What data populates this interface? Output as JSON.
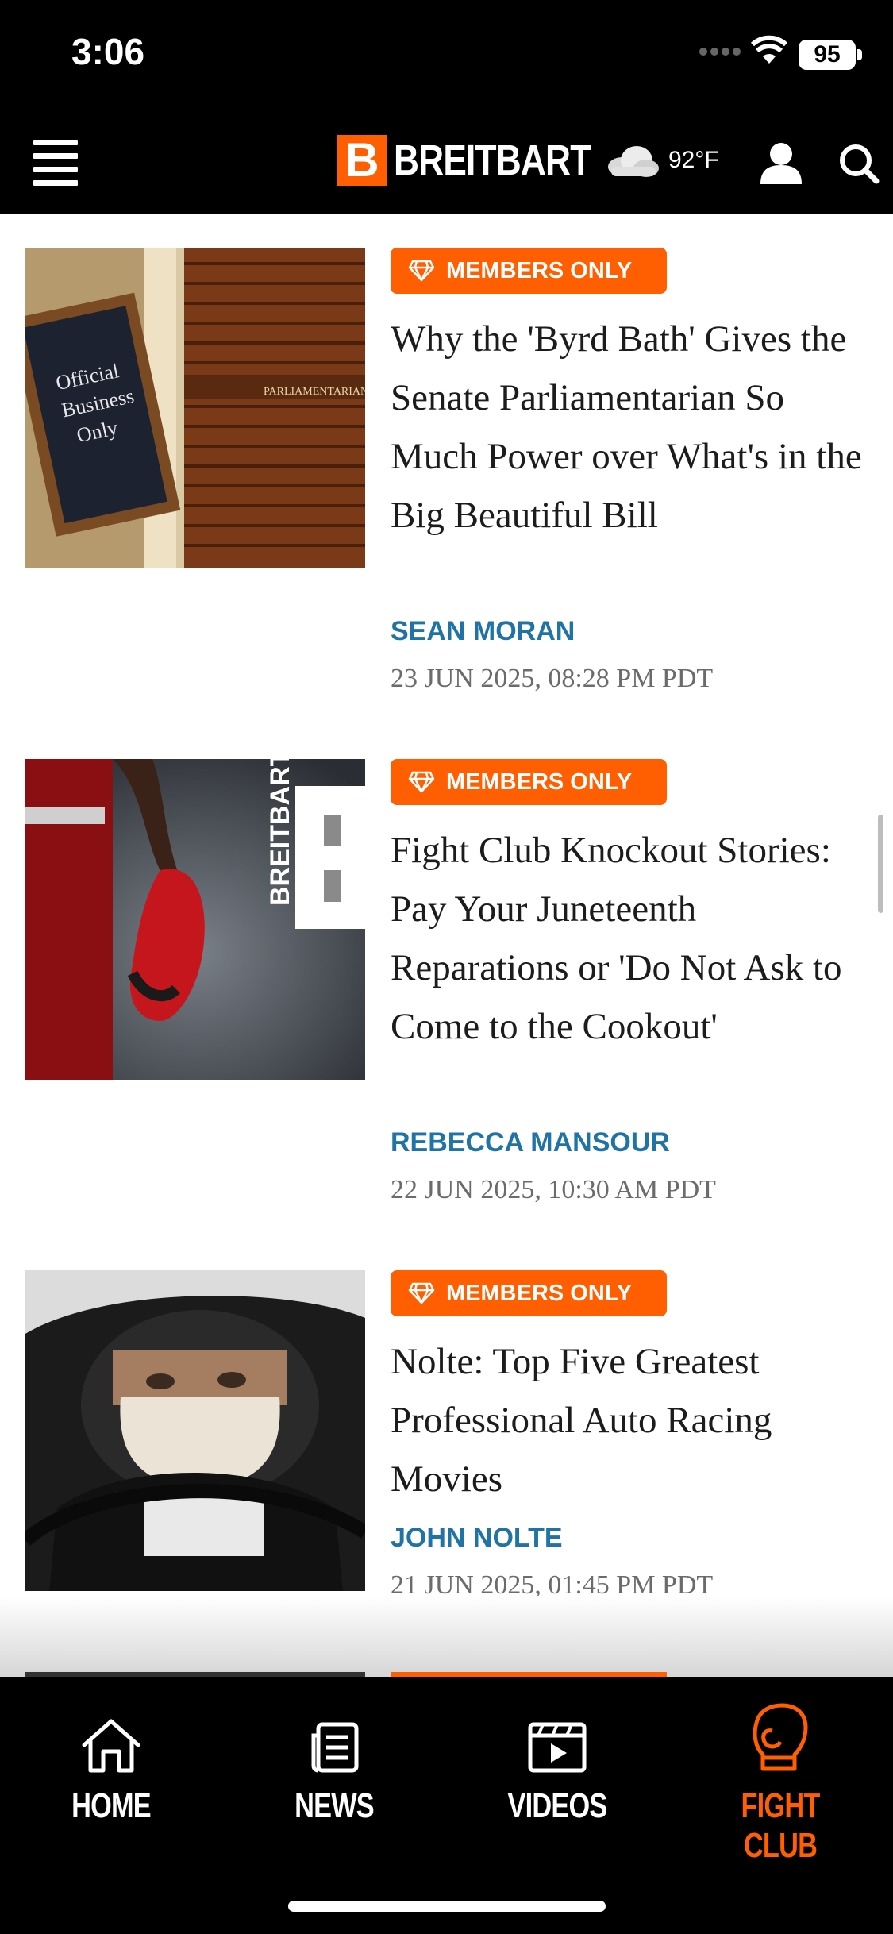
{
  "status": {
    "time": "3:06",
    "battery": "95"
  },
  "header": {
    "logo_letter": "B",
    "logo_text": "BREITBART",
    "weather_temp": "92°F"
  },
  "articles": [
    {
      "badge": "MEMBERS ONLY",
      "title": "Why the 'Byrd Bath' Gives the Senate Parliamentarian So Much Power over What's in the Big Beautiful Bill",
      "author": "SEAN MORAN",
      "date": "23 JUN 2025, 08:28 PM PDT",
      "image_sign": [
        "Official",
        "Business",
        "Only"
      ],
      "image_door_label": "PARLIAMENTARIAN"
    },
    {
      "badge": "MEMBERS ONLY",
      "title": "Fight Club Knockout Stories: Pay Your Juneteenth Reparations or 'Do Not Ask to Come to the Cookout'",
      "author": "REBECCA MANSOUR",
      "date": "22 JUN 2025, 10:30 AM PDT",
      "image_brand": "BREITBART"
    },
    {
      "badge": "MEMBERS ONLY",
      "title": "Nolte: Top Five Greatest Professional Auto Racing Movies",
      "author": "JOHN NOLTE",
      "date": "21 JUN 2025, 01:45 PM PDT"
    }
  ],
  "tabs": [
    {
      "label": "HOME",
      "icon": "home-icon"
    },
    {
      "label": "NEWS",
      "icon": "news-icon"
    },
    {
      "label": "VIDEOS",
      "icon": "videos-icon"
    },
    {
      "label": "FIGHT CLUB",
      "icon": "boxing-glove-icon",
      "active": true
    }
  ],
  "colors": {
    "accent": "#ff5f00",
    "author": "#1f74a5"
  }
}
